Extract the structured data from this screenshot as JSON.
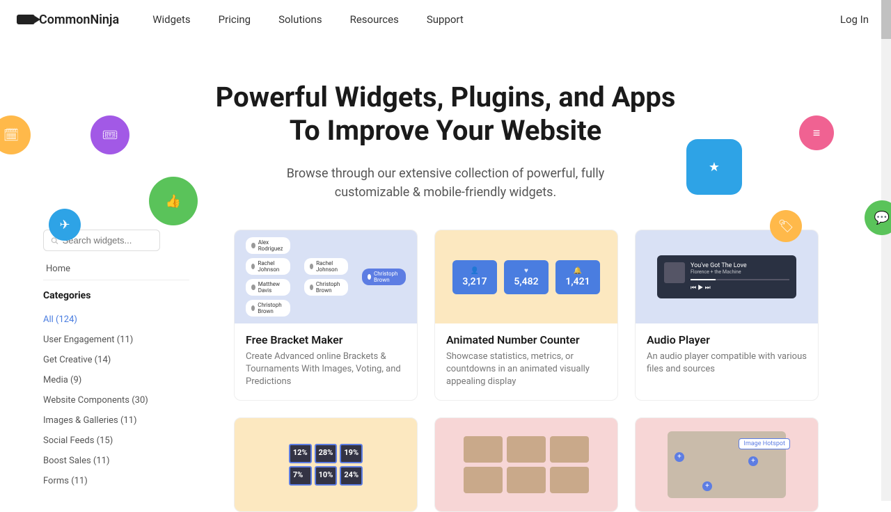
{
  "brand": "CommonNinja",
  "nav": {
    "widgets": "Widgets",
    "pricing": "Pricing",
    "solutions": "Solutions",
    "resources": "Resources",
    "support": "Support"
  },
  "login": "Log In",
  "hero": {
    "title_l1": "Powerful Widgets, Plugins, and Apps",
    "title_l2": "To Improve Your Website",
    "subtitle": "Browse through our extensive collection of powerful, fully customizable & mobile-friendly widgets."
  },
  "sidebar": {
    "search_placeholder": "Search widgets...",
    "home": "Home",
    "categories_label": "Categories",
    "items": [
      "All (124)",
      "User Engagement (11)",
      "Get Creative (14)",
      "Media (9)",
      "Website Components (30)",
      "Images & Galleries (11)",
      "Social Feeds (15)",
      "Boost Sales (11)",
      "Forms (11)"
    ]
  },
  "cards": [
    {
      "title": "Free Bracket Maker",
      "desc": "Create Advanced online Brackets & Tournaments With Images, Voting, and Predictions"
    },
    {
      "title": "Animated Number Counter",
      "desc": "Showcase statistics, metrics, or countdowns in an animated visually appealing display"
    },
    {
      "title": "Audio Player",
      "desc": "An audio player compatible with various files and sources"
    }
  ],
  "bracket_names": [
    "Alex Rodriguez",
    "Rachel Johnson",
    "Matthew Davis",
    "Christoph Brown",
    "Rachel Johnson",
    "Christoph Brown",
    "Christoph Brown"
  ],
  "counters": [
    {
      "icon": "👤",
      "value": "3,217"
    },
    {
      "icon": "♥",
      "value": "5,482"
    },
    {
      "icon": "🔔",
      "value": "1,421"
    }
  ],
  "player": {
    "track": "You've Got The Love",
    "artist": "Florence + the Machine"
  },
  "tiles_pct": [
    "12%",
    "28%",
    "19%",
    "7%",
    "10%",
    "24%"
  ],
  "hotspot_label": "Image Hotspot"
}
